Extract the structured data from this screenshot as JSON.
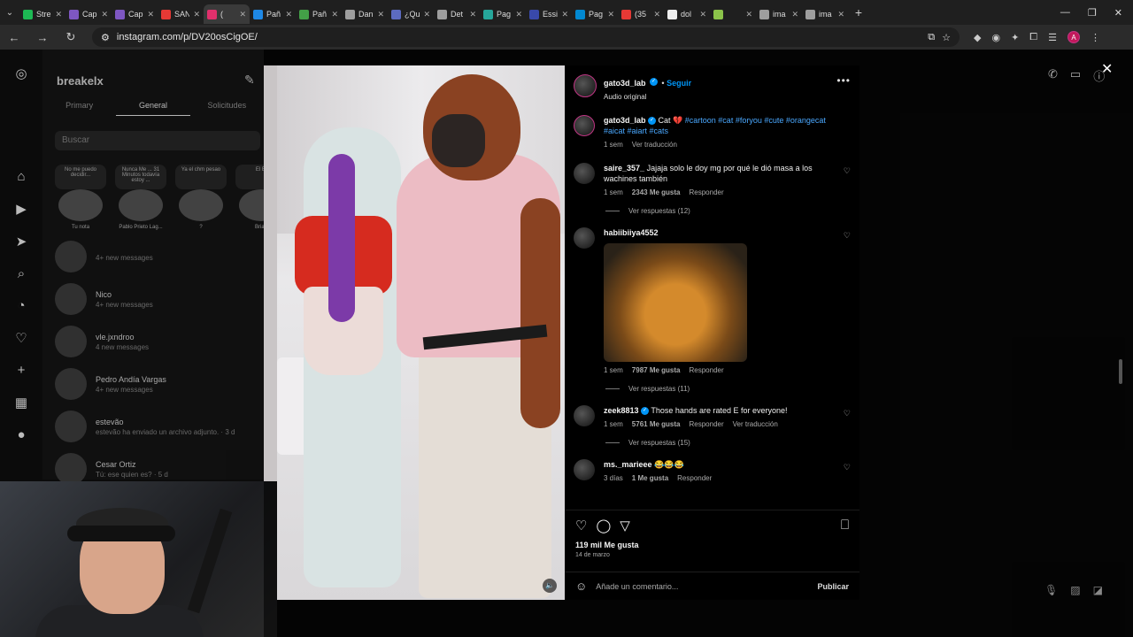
{
  "browser": {
    "tabs": [
      {
        "title": "Stre",
        "color": "#1db954"
      },
      {
        "title": "Cap",
        "color": "#7e57c2"
      },
      {
        "title": "Cap",
        "color": "#7e57c2"
      },
      {
        "title": "SAN",
        "color": "#e53935"
      },
      {
        "title": "(",
        "color": "#e1306c",
        "active": true
      },
      {
        "title": "Pañ",
        "color": "#1e88e5"
      },
      {
        "title": "Pañ",
        "color": "#43a047"
      },
      {
        "title": "Dan",
        "color": "#9e9e9e"
      },
      {
        "title": "¿Qu",
        "color": "#5c6bc0"
      },
      {
        "title": "Det",
        "color": "#9e9e9e"
      },
      {
        "title": "Pag",
        "color": "#26a69a"
      },
      {
        "title": "Essi",
        "color": "#3949ab"
      },
      {
        "title": "Pag",
        "color": "#0288d1"
      },
      {
        "title": "(35",
        "color": "#e53935"
      },
      {
        "title": "dol",
        "color": "#eeeeee"
      },
      {
        "title": "",
        "color": "#8bc34a"
      },
      {
        "title": "ima",
        "color": "#9e9e9e"
      },
      {
        "title": "ima",
        "color": "#9e9e9e"
      }
    ],
    "url": "instagram.com/p/DV20osCigOE/",
    "profile_initial": "A"
  },
  "dm": {
    "username": "breakelx",
    "tabs": [
      "Primary",
      "General",
      "Solicitudes"
    ],
    "active_tab": "General",
    "search_placeholder": "Buscar",
    "notes": [
      {
        "bubble": "No me puedo decidir...",
        "name": "Tu nota"
      },
      {
        "bubble": "Nunca Me ... 31 Minutos todavía estoy ...",
        "name": "Pablo Prieto Lag..."
      },
      {
        "bubble": "Ya el chm pesao",
        "name": "?"
      },
      {
        "bubble": "El El",
        "name": "Brian"
      }
    ],
    "conversations": [
      {
        "name": "",
        "sub": "4+ new messages"
      },
      {
        "name": "Nico",
        "sub": "4+ new messages"
      },
      {
        "name": "vle.jxndroo",
        "sub": "4 new messages"
      },
      {
        "name": "Pedro Andía Vargas",
        "sub": "4+ new messages"
      },
      {
        "name": "estevão",
        "sub": "estevão ha enviado un archivo adjunto. · 3 d"
      },
      {
        "name": "Cesar Ortiz",
        "sub": "Tú: ese quien es? · 5 d"
      }
    ]
  },
  "post": {
    "author": "gato3d_lab",
    "follow_label": "Seguir",
    "audio": "Audio original",
    "caption_text": "Cat 💔",
    "caption_tags": "#cartoon #cat #foryou #cute #orangecat #aicat #aiart #cats",
    "caption_time": "1 sem",
    "caption_translate": "Ver traducción",
    "comments": [
      {
        "user": "saire_357_",
        "text": "Jajaja solo le doy mg por qué le dió masa a los wachines también",
        "time": "1 sem",
        "likes": "2343 Me gusta",
        "reply": "Responder",
        "replies": "Ver respuestas (12)"
      },
      {
        "user": "habiibiiya4552",
        "text": "",
        "time": "1 sem",
        "likes": "7987 Me gusta",
        "reply": "Responder",
        "replies": "Ver respuestas (11)"
      },
      {
        "user": "zeek8813",
        "text": "Those hands are rated E for everyone!",
        "time": "1 sem",
        "likes": "5761 Me gusta",
        "reply": "Responder",
        "translate": "Ver traducción",
        "replies": "Ver respuestas (15)"
      },
      {
        "user": "ms._marieee",
        "text": "😂😂😂",
        "time": "3 días",
        "likes": "1 Me gusta",
        "reply": "Responder"
      }
    ],
    "likes_total": "119 mil Me gusta",
    "date": "14 de marzo",
    "comment_placeholder": "Añade un comentario...",
    "publish_label": "Publicar"
  }
}
